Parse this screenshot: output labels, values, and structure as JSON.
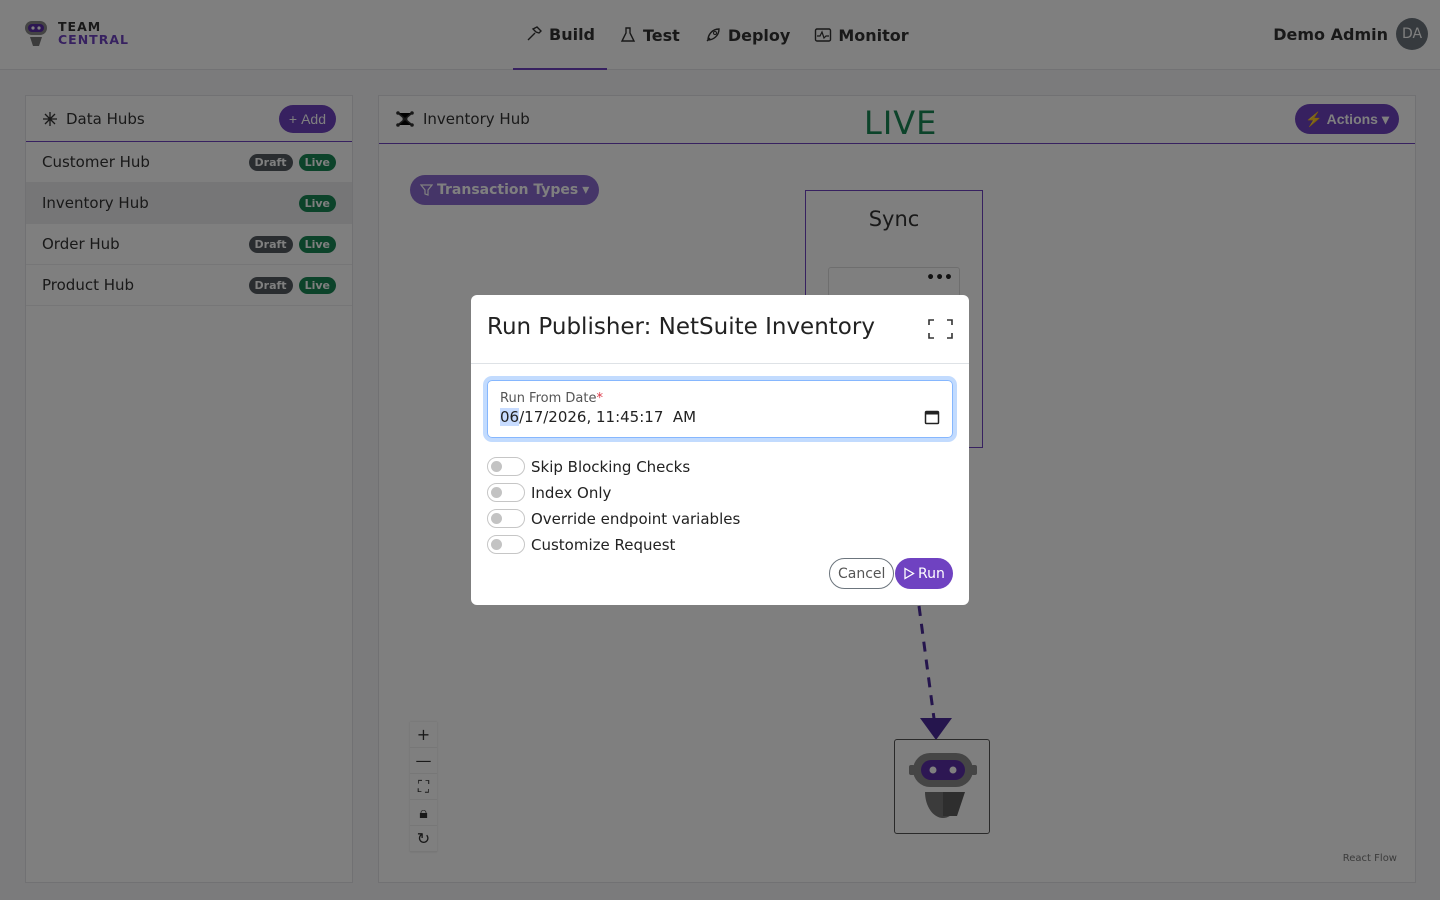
{
  "app": {
    "logo_line1": "TEAM",
    "logo_line2": "CENTRAL",
    "user_name": "Demo Admin",
    "user_initials": "DA"
  },
  "nav": [
    {
      "label": "Build",
      "icon": "hammer-icon",
      "active": true
    },
    {
      "label": "Test",
      "icon": "flask-icon",
      "active": false
    },
    {
      "label": "Deploy",
      "icon": "rocket-icon",
      "active": false
    },
    {
      "label": "Monitor",
      "icon": "activity-icon",
      "active": false
    }
  ],
  "sidebar": {
    "title": "Data Hubs",
    "add_label": "Add",
    "hubs": [
      {
        "name": "Customer Hub",
        "badges": [
          "Draft",
          "Live"
        ],
        "selected": false
      },
      {
        "name": "Inventory Hub",
        "badges": [
          "Live"
        ],
        "selected": true
      },
      {
        "name": "Order Hub",
        "badges": [
          "Draft",
          "Live"
        ],
        "selected": false
      },
      {
        "name": "Product Hub",
        "badges": [
          "Draft",
          "Live"
        ],
        "selected": false
      }
    ]
  },
  "main": {
    "title": "Inventory Hub",
    "status": "LIVE",
    "actions_label": "Actions",
    "filter_label": "Transaction Types",
    "sync_title": "Sync",
    "attribution": "React Flow"
  },
  "modal": {
    "title": "Run Publisher: NetSuite Inventory",
    "date_label": "Run From Date",
    "date_required_mark": "*",
    "date_month": "06",
    "date_rest": "/17/2026, 11:45:17  AM",
    "switches": [
      {
        "label": "Skip Blocking Checks",
        "checked": false
      },
      {
        "label": "Index Only",
        "checked": false
      },
      {
        "label": "Override endpoint variables",
        "checked": false
      },
      {
        "label": "Customize Request",
        "checked": false
      }
    ],
    "cancel_label": "Cancel",
    "run_label": "Run"
  },
  "colors": {
    "primary": "#6f42c1",
    "live": "#198754",
    "draft": "#555b61"
  }
}
